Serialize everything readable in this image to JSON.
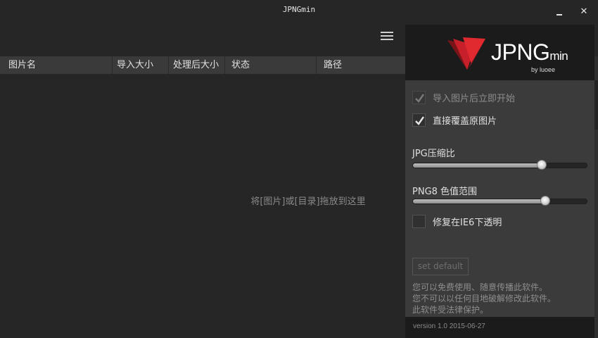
{
  "window": {
    "title": "JPNGmin",
    "minimize_label": "",
    "close_label": "✕"
  },
  "table": {
    "columns": [
      "图片名",
      "导入大小",
      "处理后大小",
      "状态",
      "路径"
    ],
    "drop_hint": "将[图片]或[目录]拖放到这里"
  },
  "panel": {
    "logo_text": "JPNG",
    "logo_suffix": "min",
    "logo_by": "by luoee",
    "options": {
      "auto_start": {
        "label": "导入图片后立即开始",
        "checked": true,
        "enabled": false
      },
      "overwrite": {
        "label": "直接覆盖原图片",
        "checked": true,
        "enabled": true
      },
      "ie6_transparent": {
        "label": "修复在IE6下透明",
        "checked": false,
        "enabled": true
      }
    },
    "jpg_slider": {
      "label": "JPG压缩比",
      "value_fraction": 0.74
    },
    "png_slider": {
      "label": "PNG8 色值范围",
      "value_fraction": 0.76
    },
    "set_default_label": "set default",
    "notice": [
      "您可以免费使用、随意传播此软件。",
      "您不可以以任何目地破解修改此软件。",
      "此软件受法律保护。"
    ],
    "version": "version 1.0 2015-06-27"
  },
  "colors": {
    "background": "#262626",
    "panel": "#3b3b3b",
    "logo_red": "#c8202a",
    "header": "#3a3a3a"
  },
  "icons": [
    "menu-icon",
    "checkmark-icon",
    "logo-mark-icon",
    "minimize-icon",
    "close-icon"
  ]
}
